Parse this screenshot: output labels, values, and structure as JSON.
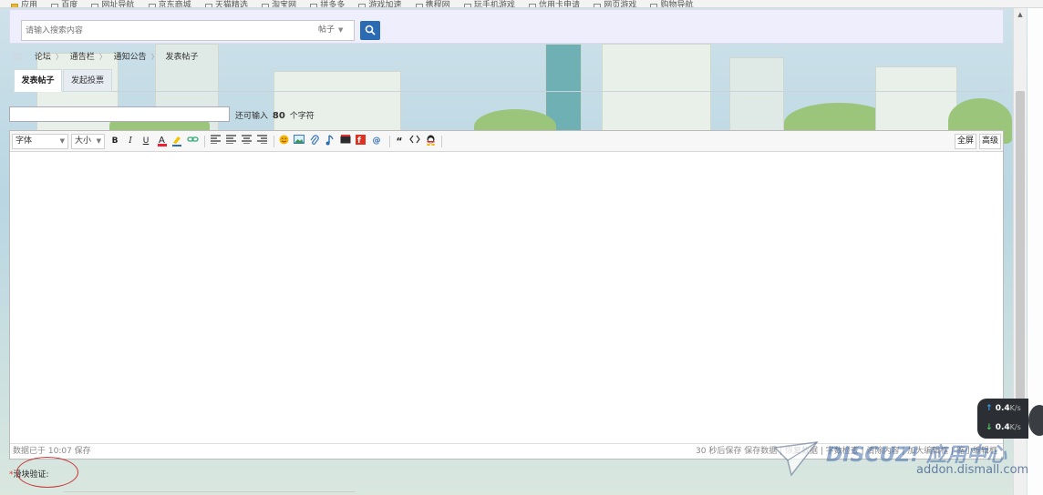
{
  "bookmarks": [
    "应用",
    "百度",
    "网址导航",
    "京东商城",
    "天猫精选",
    "淘宝网",
    "拼多多",
    "游戏加速",
    "携程网",
    "玩手机游戏",
    "信用卡申请",
    "网页游戏",
    "购物导航"
  ],
  "search": {
    "placeholder": "请输入搜索内容",
    "type_label": "帖子"
  },
  "breadcrumb": [
    "论坛",
    "通告栏",
    "通知公告",
    "发表帖子"
  ],
  "tabs": [
    {
      "label": "发表帖子",
      "active": true
    },
    {
      "label": "发起投票",
      "active": false
    }
  ],
  "title": {
    "hint_prefix": "还可输入",
    "remaining": "80",
    "hint_suffix": "个字符"
  },
  "editor": {
    "font_label": "字体",
    "size_label": "大小",
    "bold": "B",
    "italic": "I",
    "underline": "U",
    "fullscreen_label": "全屏",
    "advanced_label": "高级",
    "icons": [
      "font-color-icon",
      "background-color-icon",
      "link-icon",
      "align-left-icon",
      "align-left2-icon",
      "align-center-icon",
      "align-right-icon",
      "emoji-icon",
      "image-icon",
      "attachment-icon",
      "music-icon",
      "video-icon",
      "flash-icon",
      "at-icon",
      "quote-icon",
      "code-icon",
      "qq-icon"
    ],
    "status_left": "数据已于 10:07 保存",
    "status_right": "30 秒后保存 保存数据 | 恢复数据 | 字数检查 | 清除内容 | 加大编辑框 | 缩小编辑框"
  },
  "captcha": {
    "required_mark": "*",
    "label": "滑块验证:"
  },
  "netspeed": {
    "up_value": "0.4",
    "up_unit": "K/s",
    "down_value": "0.4",
    "down_unit": "K/s"
  },
  "watermark": {
    "logo": "DISCUZ! 应用中心",
    "site": "addon.dismall.com"
  },
  "colors": {
    "accent": "#2a6bb3",
    "search_bg": "#eeeefc",
    "tab_inactive": "#e6ecf2"
  }
}
